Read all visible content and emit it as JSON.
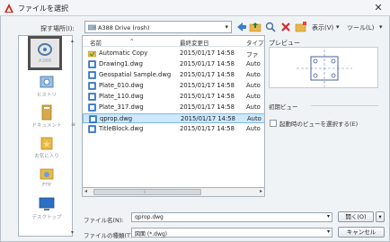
{
  "window": {
    "title": "ファイルを選択"
  },
  "toolbar": {
    "look_in_label": "探す場所(I):",
    "look_in_value": "A388 Drive (rosh)",
    "views_label": "表示(V)",
    "tools_label": "ツール(L)"
  },
  "places": [
    {
      "label": "A388"
    },
    {
      "label": "ヒストリ"
    },
    {
      "label": "ドキュメント"
    },
    {
      "label": "お気に入り"
    },
    {
      "label": "FTP"
    },
    {
      "label": "デスクトップ"
    }
  ],
  "file_list": {
    "columns": [
      "名前",
      "最終変更日",
      "タイプ"
    ],
    "rows": [
      {
        "name": "Automatic Copy",
        "date": "2015/01/17 14:58",
        "type": "ファ",
        "icon": "folder-icon"
      },
      {
        "name": "Drawing1.dwg",
        "date": "2015/01/17 14:58",
        "type": "Auto",
        "icon": "dwg-icon"
      },
      {
        "name": "Geospatial Sample.dwg",
        "date": "2015/01/17 14:58",
        "type": "Auto",
        "icon": "dwg-icon"
      },
      {
        "name": "Plate_010.dwg",
        "date": "2015/01/17 14:58",
        "type": "Auto",
        "icon": "dwg-icon"
      },
      {
        "name": "Plate_110.dwg",
        "date": "2015/01/17 14:58",
        "type": "Auto",
        "icon": "dwg-icon"
      },
      {
        "name": "Plate_317.dwg",
        "date": "2015/01/17 14:58",
        "type": "Auto",
        "icon": "dwg-icon"
      },
      {
        "name": "qprop.dwg",
        "date": "2015/01/17 14:58",
        "type": "Auto",
        "icon": "dwg-icon",
        "selected": true
      },
      {
        "name": "TitleBlock.dwg",
        "date": "2015/01/17 14:58",
        "type": "Auto",
        "icon": "dwg-icon"
      }
    ]
  },
  "preview": {
    "label": "プレビュー",
    "initial_view_label": "初期ビュー",
    "checkbox_label": "起動時のビューを選択する(E)"
  },
  "footer": {
    "file_name_label": "ファイル名(N):",
    "file_name_value": "qprop.dwg",
    "file_type_label": "ファイルの種類(T):",
    "file_type_value": "図面 (*.dwg)",
    "open_button": "開く(O)",
    "cancel_button": "キャンセル"
  },
  "colors": {
    "accent": "#cc2b1d",
    "selection": "#cde8ff",
    "frame": "#f0f3f6"
  }
}
